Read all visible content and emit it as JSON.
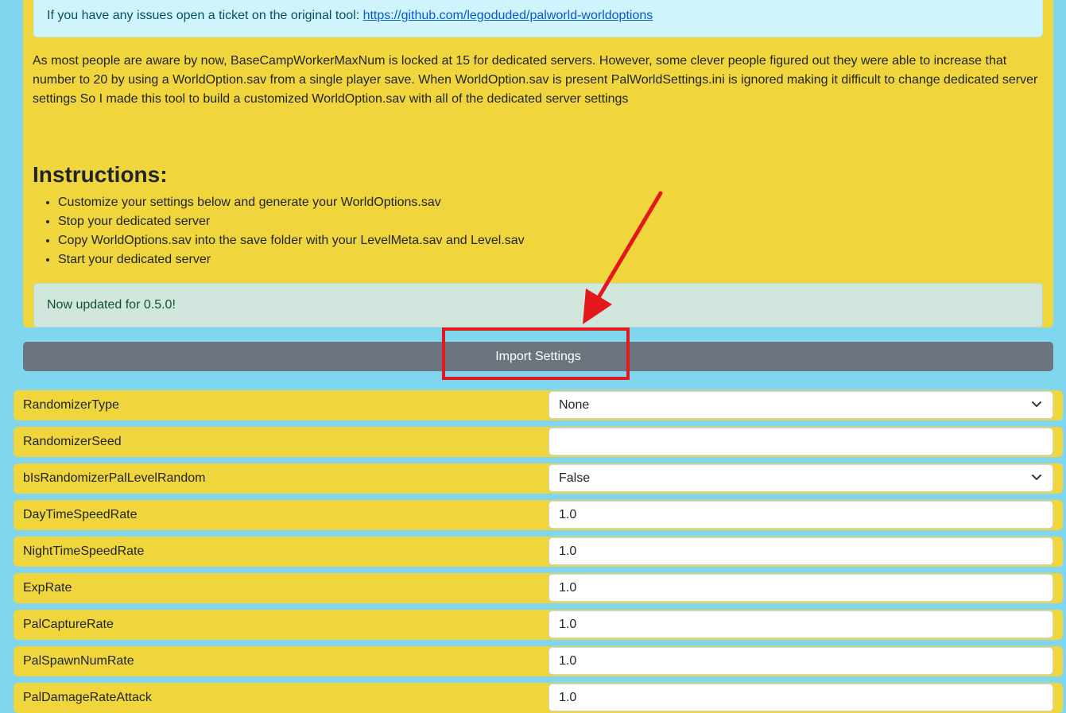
{
  "info_alert": {
    "text": "If you have any issues open a ticket on the original tool: ",
    "link": "https://github.com/legoduded/palworld-worldoptions"
  },
  "description": "As most people are aware by now, BaseCampWorkerMaxNum is locked at 15 for dedicated servers. However, some clever people figured out they were able to increase that number to 20 by using a WorldOption.sav from a single player save. When WorldOption.sav is present PalWorldSettings.ini is ignored making it difficult to change dedicated server settings So I made this tool to build a customized WorldOption.sav with all of the dedicated server settings",
  "instructions": {
    "heading": "Instructions:",
    "items": [
      "Customize your settings below and generate your WorldOptions.sav",
      "Stop your dedicated server",
      "Copy WorldOptions.sav into the save folder with your LevelMeta.sav and Level.sav",
      "Start your dedicated server"
    ]
  },
  "success_alert": "Now updated for 0.5.0!",
  "import_button": "Import Settings",
  "settings": [
    {
      "label": "RandomizerType",
      "type": "select",
      "value": "None"
    },
    {
      "label": "RandomizerSeed",
      "type": "input",
      "value": ""
    },
    {
      "label": "bIsRandomizerPalLevelRandom",
      "type": "select",
      "value": "False"
    },
    {
      "label": "DayTimeSpeedRate",
      "type": "input",
      "value": "1.0"
    },
    {
      "label": "NightTimeSpeedRate",
      "type": "input",
      "value": "1.0"
    },
    {
      "label": "ExpRate",
      "type": "input",
      "value": "1.0"
    },
    {
      "label": "PalCaptureRate",
      "type": "input",
      "value": "1.0"
    },
    {
      "label": "PalSpawnNumRate",
      "type": "input",
      "value": "1.0"
    },
    {
      "label": "PalDamageRateAttack",
      "type": "input",
      "value": "1.0"
    }
  ],
  "colors": {
    "page_background": "#7fd6ee",
    "card_background": "#f0d63c",
    "annotation_red": "#e3181d",
    "button_gray": "#6c757d"
  }
}
